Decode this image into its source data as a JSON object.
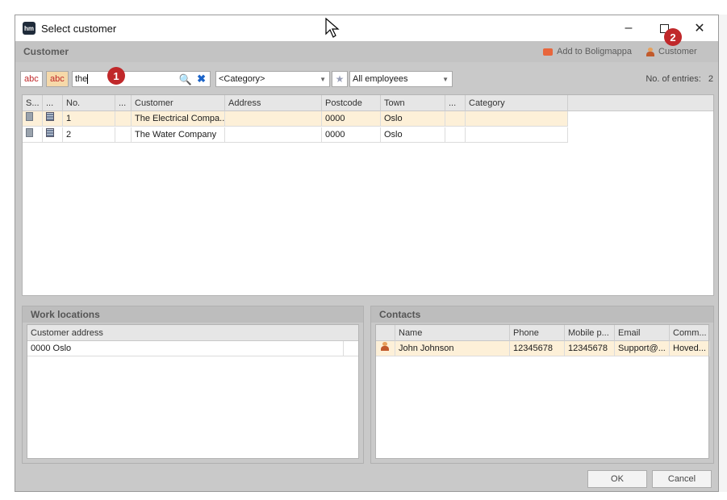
{
  "window": {
    "title": "Select customer",
    "app_icon_text": "hm"
  },
  "header": {
    "title": "Customer",
    "add_to_boligmappa": "Add to Boligmappa",
    "customer_btn": "Customer"
  },
  "toolbar": {
    "abc1": "abc",
    "abc2": "abc",
    "search_value": "the",
    "category_value": "<Category>",
    "employees_value": "All employees",
    "entries_label": "No. of entries:",
    "entries_count": "2"
  },
  "badges": {
    "one": "1",
    "two": "2"
  },
  "grid": {
    "headers": [
      "S...",
      "...",
      "No.",
      "...",
      "Customer",
      "Address",
      "Postcode",
      "Town",
      "...",
      "Category"
    ],
    "rows": [
      {
        "no": "1",
        "customer": "The Electrical Compa...",
        "address": "",
        "postcode": "0000",
        "town": "Oslo",
        "category": ""
      },
      {
        "no": "2",
        "customer": "The Water Company",
        "address": "",
        "postcode": "0000",
        "town": "Oslo",
        "category": ""
      }
    ]
  },
  "work_locations": {
    "title": "Work locations",
    "column": "Customer address",
    "rows": [
      "0000 Oslo"
    ]
  },
  "contacts": {
    "title": "Contacts",
    "headers": [
      "Name",
      "Phone",
      "Mobile p...",
      "Email",
      "Comm..."
    ],
    "rows": [
      {
        "name": "John Johnson",
        "phone": "12345678",
        "mobile": "12345678",
        "email": "Support@...",
        "comment": "Hoved..."
      }
    ]
  },
  "footer": {
    "ok": "OK",
    "cancel": "Cancel"
  },
  "colors": {
    "accent_badge": "#c0282a",
    "row_highlight": "#fdf0d8",
    "panel_bg": "#c9c9c9"
  }
}
